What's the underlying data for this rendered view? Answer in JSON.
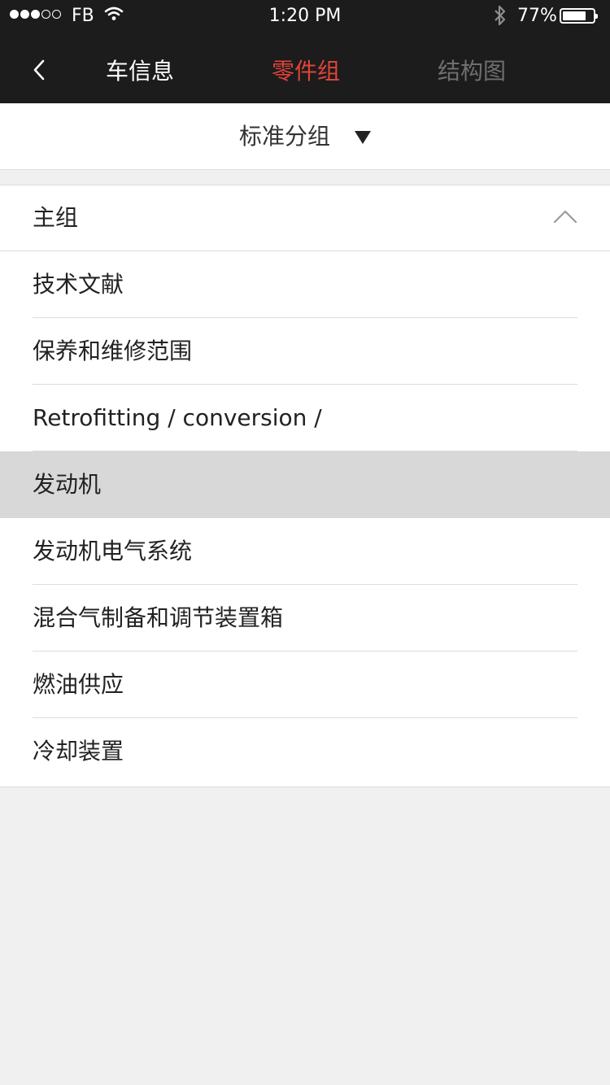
{
  "status_bar": {
    "carrier": "FB",
    "time": "1:20 PM",
    "battery_percent": "77%",
    "battery_level": 0.77,
    "signal_bars_filled": 3,
    "signal_bars_total": 5
  },
  "nav": {
    "back_icon": "chevron-left-icon",
    "tabs": [
      {
        "label": "车信息",
        "active": false
      },
      {
        "label": "零件组",
        "active": true
      },
      {
        "label": "结构图",
        "active": false
      }
    ],
    "active_color": "#e0433a"
  },
  "selector": {
    "label": "标准分组",
    "icon": "triangle-down-icon"
  },
  "section": {
    "title": "主组",
    "expanded": true,
    "icon": "chevron-up-icon"
  },
  "items": [
    {
      "label": "技术文献",
      "selected": false
    },
    {
      "label": "保养和维修范围",
      "selected": false
    },
    {
      "label": "Retrofitting / conversion /",
      "selected": false
    },
    {
      "label": "发动机",
      "selected": true
    },
    {
      "label": "发动机电气系统",
      "selected": false
    },
    {
      "label": "混合气制备和调节装置箱",
      "selected": false
    },
    {
      "label": "燃油供应",
      "selected": false
    },
    {
      "label": "冷却装置",
      "selected": false
    }
  ]
}
